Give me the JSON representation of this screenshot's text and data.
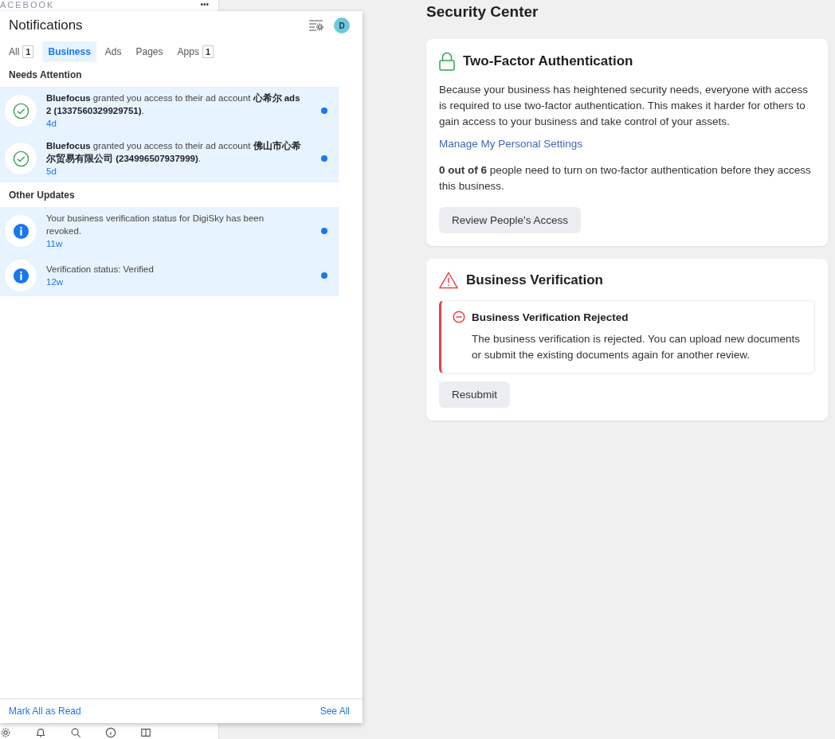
{
  "sidebar": {
    "logo": "ACEBOOK",
    "more": "•••",
    "bottom_icons": [
      {
        "kind": "gear"
      },
      {
        "kind": "bell"
      },
      {
        "kind": "search"
      },
      {
        "kind": "info"
      },
      {
        "kind": "book"
      }
    ]
  },
  "notifications": {
    "title": "Notifications",
    "avatar": "D",
    "tabs": [
      {
        "label": "All",
        "count": "1",
        "selected": false
      },
      {
        "label": "Business",
        "selected": true
      },
      {
        "label": "Ads",
        "selected": false
      },
      {
        "label": "Pages",
        "selected": false
      },
      {
        "label": "Apps",
        "count": "1",
        "selected": false
      }
    ],
    "sections": [
      {
        "heading": "Needs Attention",
        "items": [
          {
            "kind": "granted",
            "text": "**Bluefocus** granted you access to their ad account **心希尔 ads 2 (1337560329929751)**.",
            "time": "4d",
            "unread": true
          },
          {
            "kind": "granted",
            "text": "**Bluefocus** granted you access to their ad account **佛山市心希尔贸易有限公司 (234996507937999)**.",
            "time": "5d",
            "unread": true
          }
        ]
      },
      {
        "heading": "Other Updates",
        "items": [
          {
            "kind": "info",
            "text": "Your business verification status for DigiSky has been revoked.",
            "time": "11w",
            "unread": true
          },
          {
            "kind": "info",
            "text": "Verification status: Verified",
            "time": "12w",
            "unread": true
          }
        ]
      }
    ],
    "footer": {
      "mark_all": "Mark All as Read",
      "see_all": "See All"
    }
  },
  "security_center": {
    "title": "Security Center",
    "two_factor": {
      "title": "Two-Factor Authentication",
      "description": "Because your business has heightened security needs, everyone with access is required to use two-factor authentication. This makes it harder for others to gain access to your business and take control of your assets.",
      "link": "Manage My Personal Settings",
      "status": "**0 out of 6** people need to turn on two-factor authentication before they access this business.",
      "button": "Review People's Access"
    },
    "verification": {
      "title": "Business Verification",
      "alert_title": "Business Verification Rejected",
      "alert_text": "The business verification is rejected. You can upload new documents or submit the existing documents again for another review.",
      "button": "Resubmit"
    }
  }
}
